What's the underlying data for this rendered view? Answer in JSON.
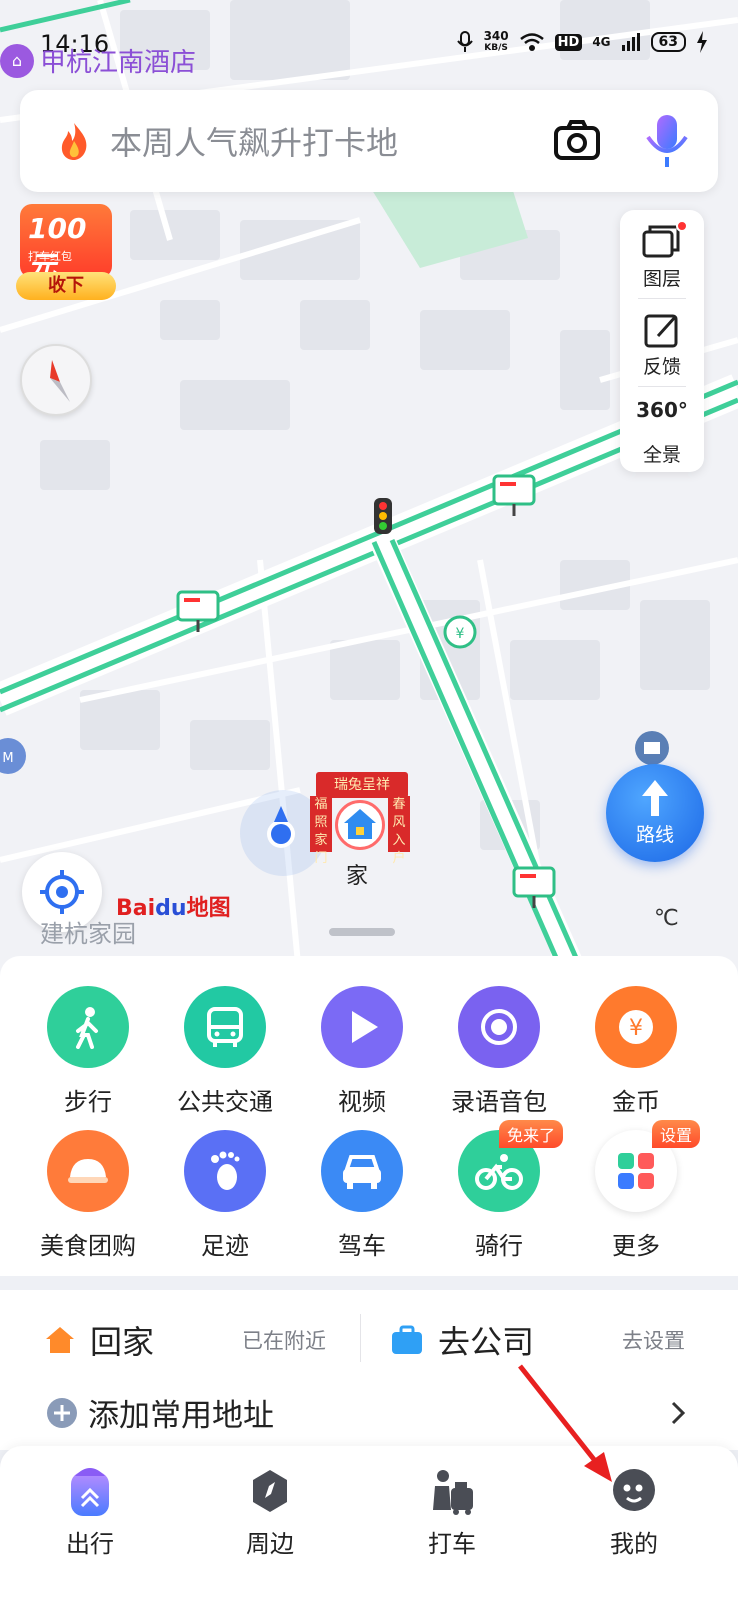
{
  "status_bar": {
    "time": "14:16",
    "speed_value": "340",
    "speed_unit": "KB/S",
    "hd": "HD",
    "network": "4G",
    "battery": "63"
  },
  "map": {
    "top_poi": "甲杭江南酒店",
    "search_placeholder": "本周人气飙升打卡地",
    "red_packet": {
      "amount": "100元",
      "sub": "打车红包",
      "button": "收下"
    },
    "tools": [
      {
        "label": "图层",
        "icon": "layers-icon"
      },
      {
        "label": "反馈",
        "icon": "feedback-icon"
      },
      {
        "label": "全景",
        "icon": "panorama-360-icon",
        "badge": "360°"
      }
    ],
    "route_button": "路线",
    "home_marker": {
      "banner": "瑞兔呈祥",
      "left": "福照家门",
      "right": "春风入户",
      "label": "家"
    },
    "logo": {
      "bai": "Bai",
      "du": "du",
      "ditu": "地图"
    },
    "area_label": "建杭家园",
    "temperature": "℃"
  },
  "services": [
    {
      "label": "步行",
      "icon": "walk-icon",
      "color": "#2fcf9a"
    },
    {
      "label": "公共交通",
      "icon": "bus-icon",
      "color": "#22c9a3"
    },
    {
      "label": "视频",
      "icon": "video-play-icon",
      "color": "#7b6af5"
    },
    {
      "label": "录语音包",
      "icon": "voice-pack-icon",
      "color": "#7a62f0"
    },
    {
      "label": "金币",
      "icon": "coin-icon",
      "color": "#ff7a2d"
    },
    {
      "label": "美食团购",
      "icon": "food-icon",
      "color": "#ff7b3a"
    },
    {
      "label": "足迹",
      "icon": "footprint-icon",
      "color": "#5a70f5"
    },
    {
      "label": "驾车",
      "icon": "car-icon",
      "color": "#3b8af5"
    },
    {
      "label": "骑行",
      "icon": "bike-icon",
      "color": "#2fcf9a",
      "badge": "免来了"
    },
    {
      "label": "更多",
      "icon": "more-grid-icon",
      "color": "#ffffff",
      "badge": "设置"
    }
  ],
  "shortcuts": {
    "home_title": "回家",
    "home_status": "已在附近",
    "company_title": "去公司",
    "company_action": "去设置",
    "add_address": "添加常用地址"
  },
  "tabs": [
    {
      "label": "出行",
      "icon": "travel-icon"
    },
    {
      "label": "周边",
      "icon": "nearby-compass-icon"
    },
    {
      "label": "打车",
      "icon": "taxi-icon"
    },
    {
      "label": "我的",
      "icon": "profile-icon"
    }
  ],
  "colors": {
    "accent": "#1b67e6",
    "road": "#3fcf99",
    "annotation_arrow": "#e82020"
  }
}
